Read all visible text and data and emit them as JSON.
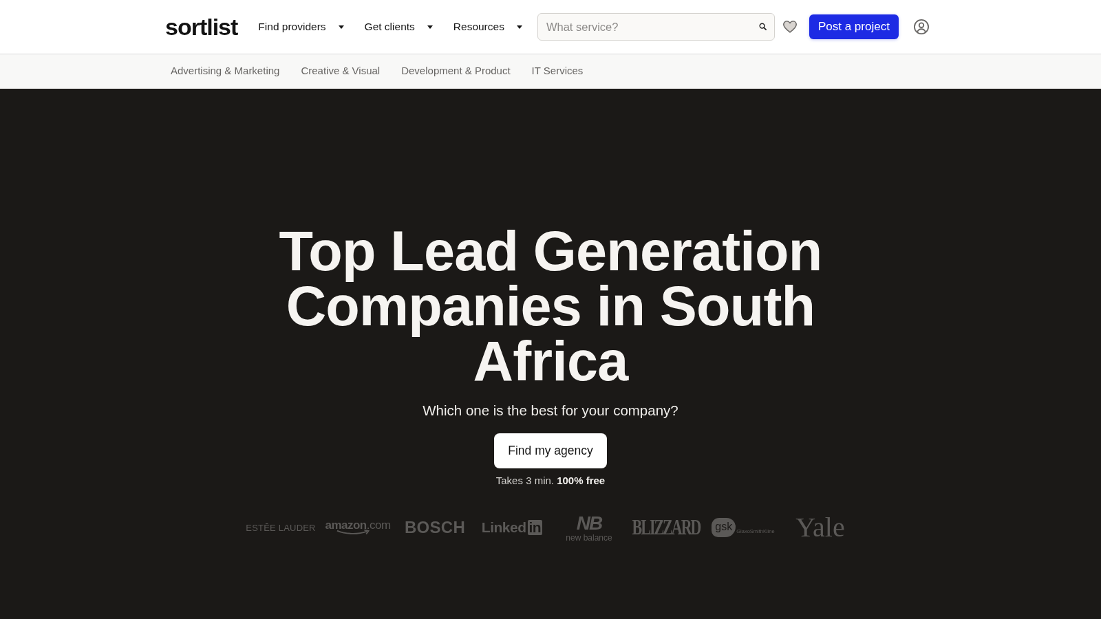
{
  "header": {
    "logo": "sortlist",
    "nav": [
      {
        "label": "Find providers"
      },
      {
        "label": "Get clients"
      },
      {
        "label": "Resources"
      }
    ],
    "search": {
      "placeholder": "What service?"
    },
    "post_button": "Post a project"
  },
  "categories": [
    {
      "label": "Advertising & Marketing"
    },
    {
      "label": "Creative & Visual"
    },
    {
      "label": "Development & Product"
    },
    {
      "label": "IT Services"
    }
  ],
  "hero": {
    "title": "Top Lead Generation Companies in South Africa",
    "subtitle": "Which one is the best for your company?",
    "cta": "Find my agency",
    "note": "Takes 3 min. **100% free**"
  },
  "client_logos": [
    {
      "kind": "estee",
      "text": "ESTĒE LAUDER"
    },
    {
      "kind": "amazon",
      "text": "**amazon**.com"
    },
    {
      "kind": "bosch",
      "text": "BOSCH"
    },
    {
      "kind": "linkedin",
      "text": "Linked",
      "badge": "in"
    },
    {
      "kind": "newbalance",
      "mark": "NB",
      "text": "new balance"
    },
    {
      "kind": "blizzard",
      "text": "BLIZZARD"
    },
    {
      "kind": "gsk",
      "mark": "gsk",
      "text": "GlaxoSmithKline"
    },
    {
      "kind": "yale",
      "text": "Yale"
    }
  ]
}
